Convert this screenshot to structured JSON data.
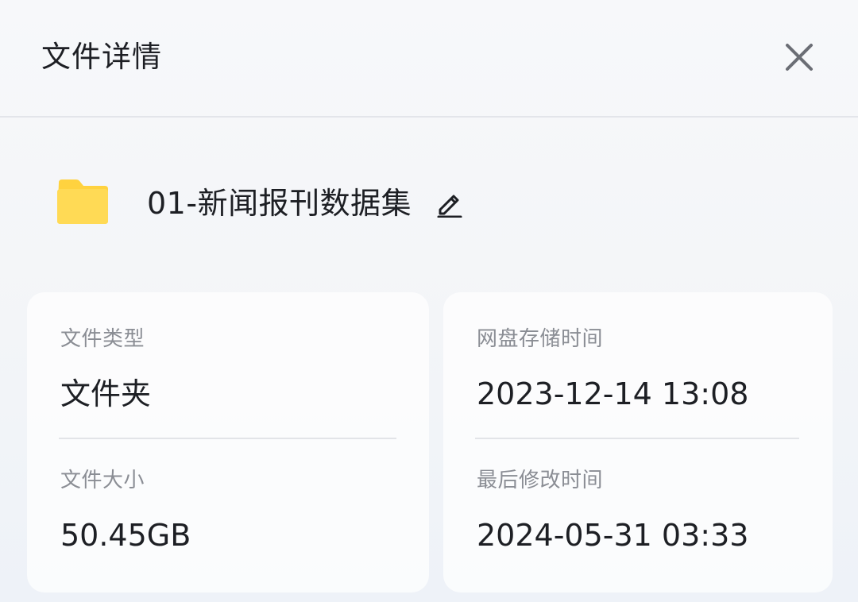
{
  "header": {
    "title": "文件详情",
    "close_icon": "close-icon"
  },
  "file": {
    "name": "01-新闻报刊数据集",
    "icon": "folder-icon",
    "icon_color": "#FFD84D",
    "edit_icon": "pencil-icon"
  },
  "details": {
    "type_label": "文件类型",
    "type_value": "文件夹",
    "size_label": "文件大小",
    "size_value": "50.45GB",
    "stored_label": "网盘存储时间",
    "stored_value": "2023-12-14 13:08",
    "modified_label": "最后修改时间",
    "modified_value": "2024-05-31 03:33"
  }
}
